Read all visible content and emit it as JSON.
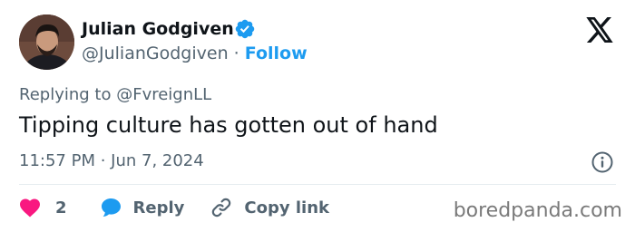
{
  "author": {
    "display_name": "Julian Godgiven",
    "handle": "@JulianGodgiven",
    "separator": "·",
    "follow_label": "Follow",
    "verified": true
  },
  "reply_context": {
    "prefix": "Replying to",
    "handle": "@FvreignLL"
  },
  "tweet": {
    "text": "Tipping culture has gotten out of hand",
    "timestamp": "11:57 PM · Jun 7, 2024"
  },
  "actions": {
    "like_count": "2",
    "reply_label": "Reply",
    "copy_link_label": "Copy link"
  },
  "watermark": "boredpanda.com",
  "colors": {
    "accent": "#1d9bf0",
    "like": "#f91880",
    "text_primary": "#0f1419",
    "text_secondary": "#536471"
  },
  "icons": {
    "verified": "verified-badge-icon",
    "platform": "x-logo-icon",
    "info": "info-icon",
    "like": "heart-icon",
    "reply": "speech-bubble-icon",
    "copy_link": "link-icon"
  }
}
